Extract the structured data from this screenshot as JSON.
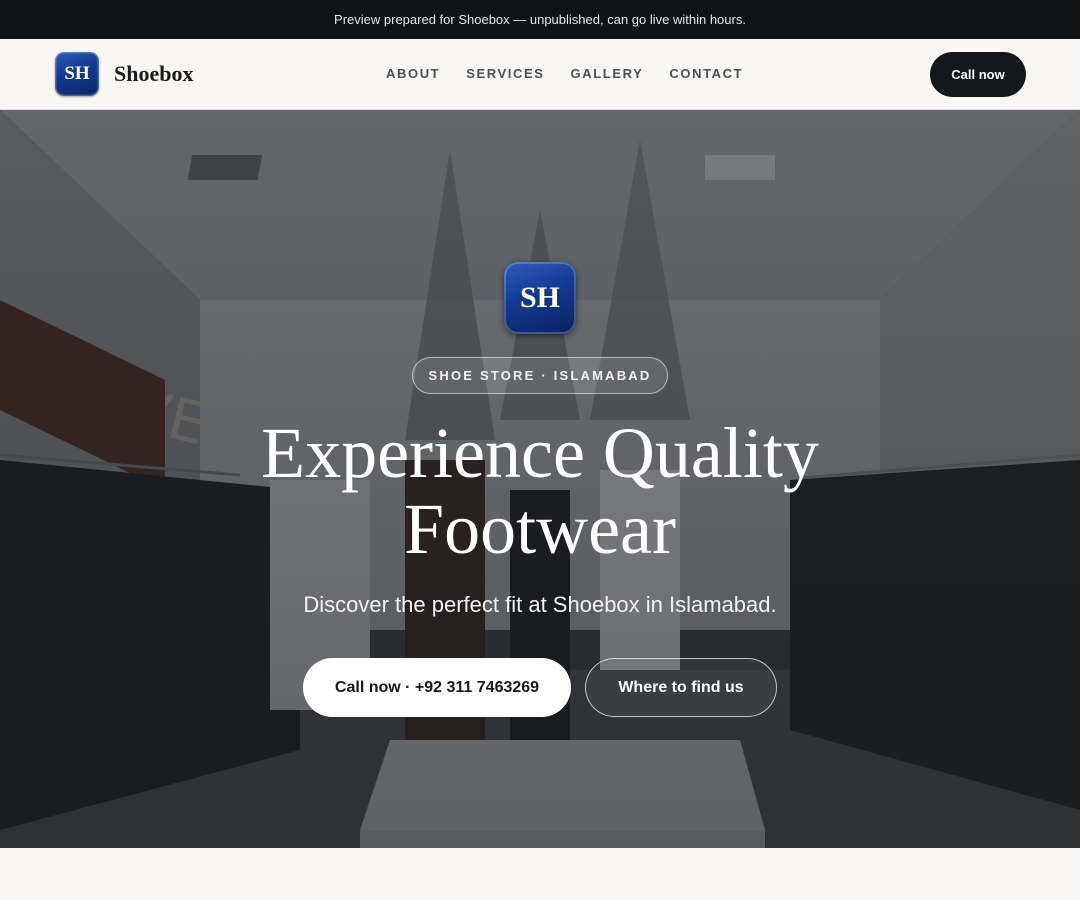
{
  "announcement": "Preview prepared for Shoebox — unpublished, can go live within hours.",
  "header": {
    "logo_text": "SH",
    "brand_name": "Shoebox",
    "nav": [
      "ABOUT",
      "SERVICES",
      "GALLERY",
      "CONTACT"
    ],
    "cta_label": "Call now"
  },
  "hero": {
    "logo_text": "SH",
    "badge": "SHOE STORE · ISLAMABAD",
    "title_line1": "Experience Quality",
    "title_line2": "Footwear",
    "subtitle": "Discover the perfect fit at Shoebox in Islamabad.",
    "primary_button": "Call now · +92 311 7463269",
    "secondary_button": "Where to find us",
    "background_sign": "STEVE"
  },
  "colors": {
    "brand_blue": "#123a8f",
    "dark": "#14171c",
    "background": "#f8f7f4"
  }
}
